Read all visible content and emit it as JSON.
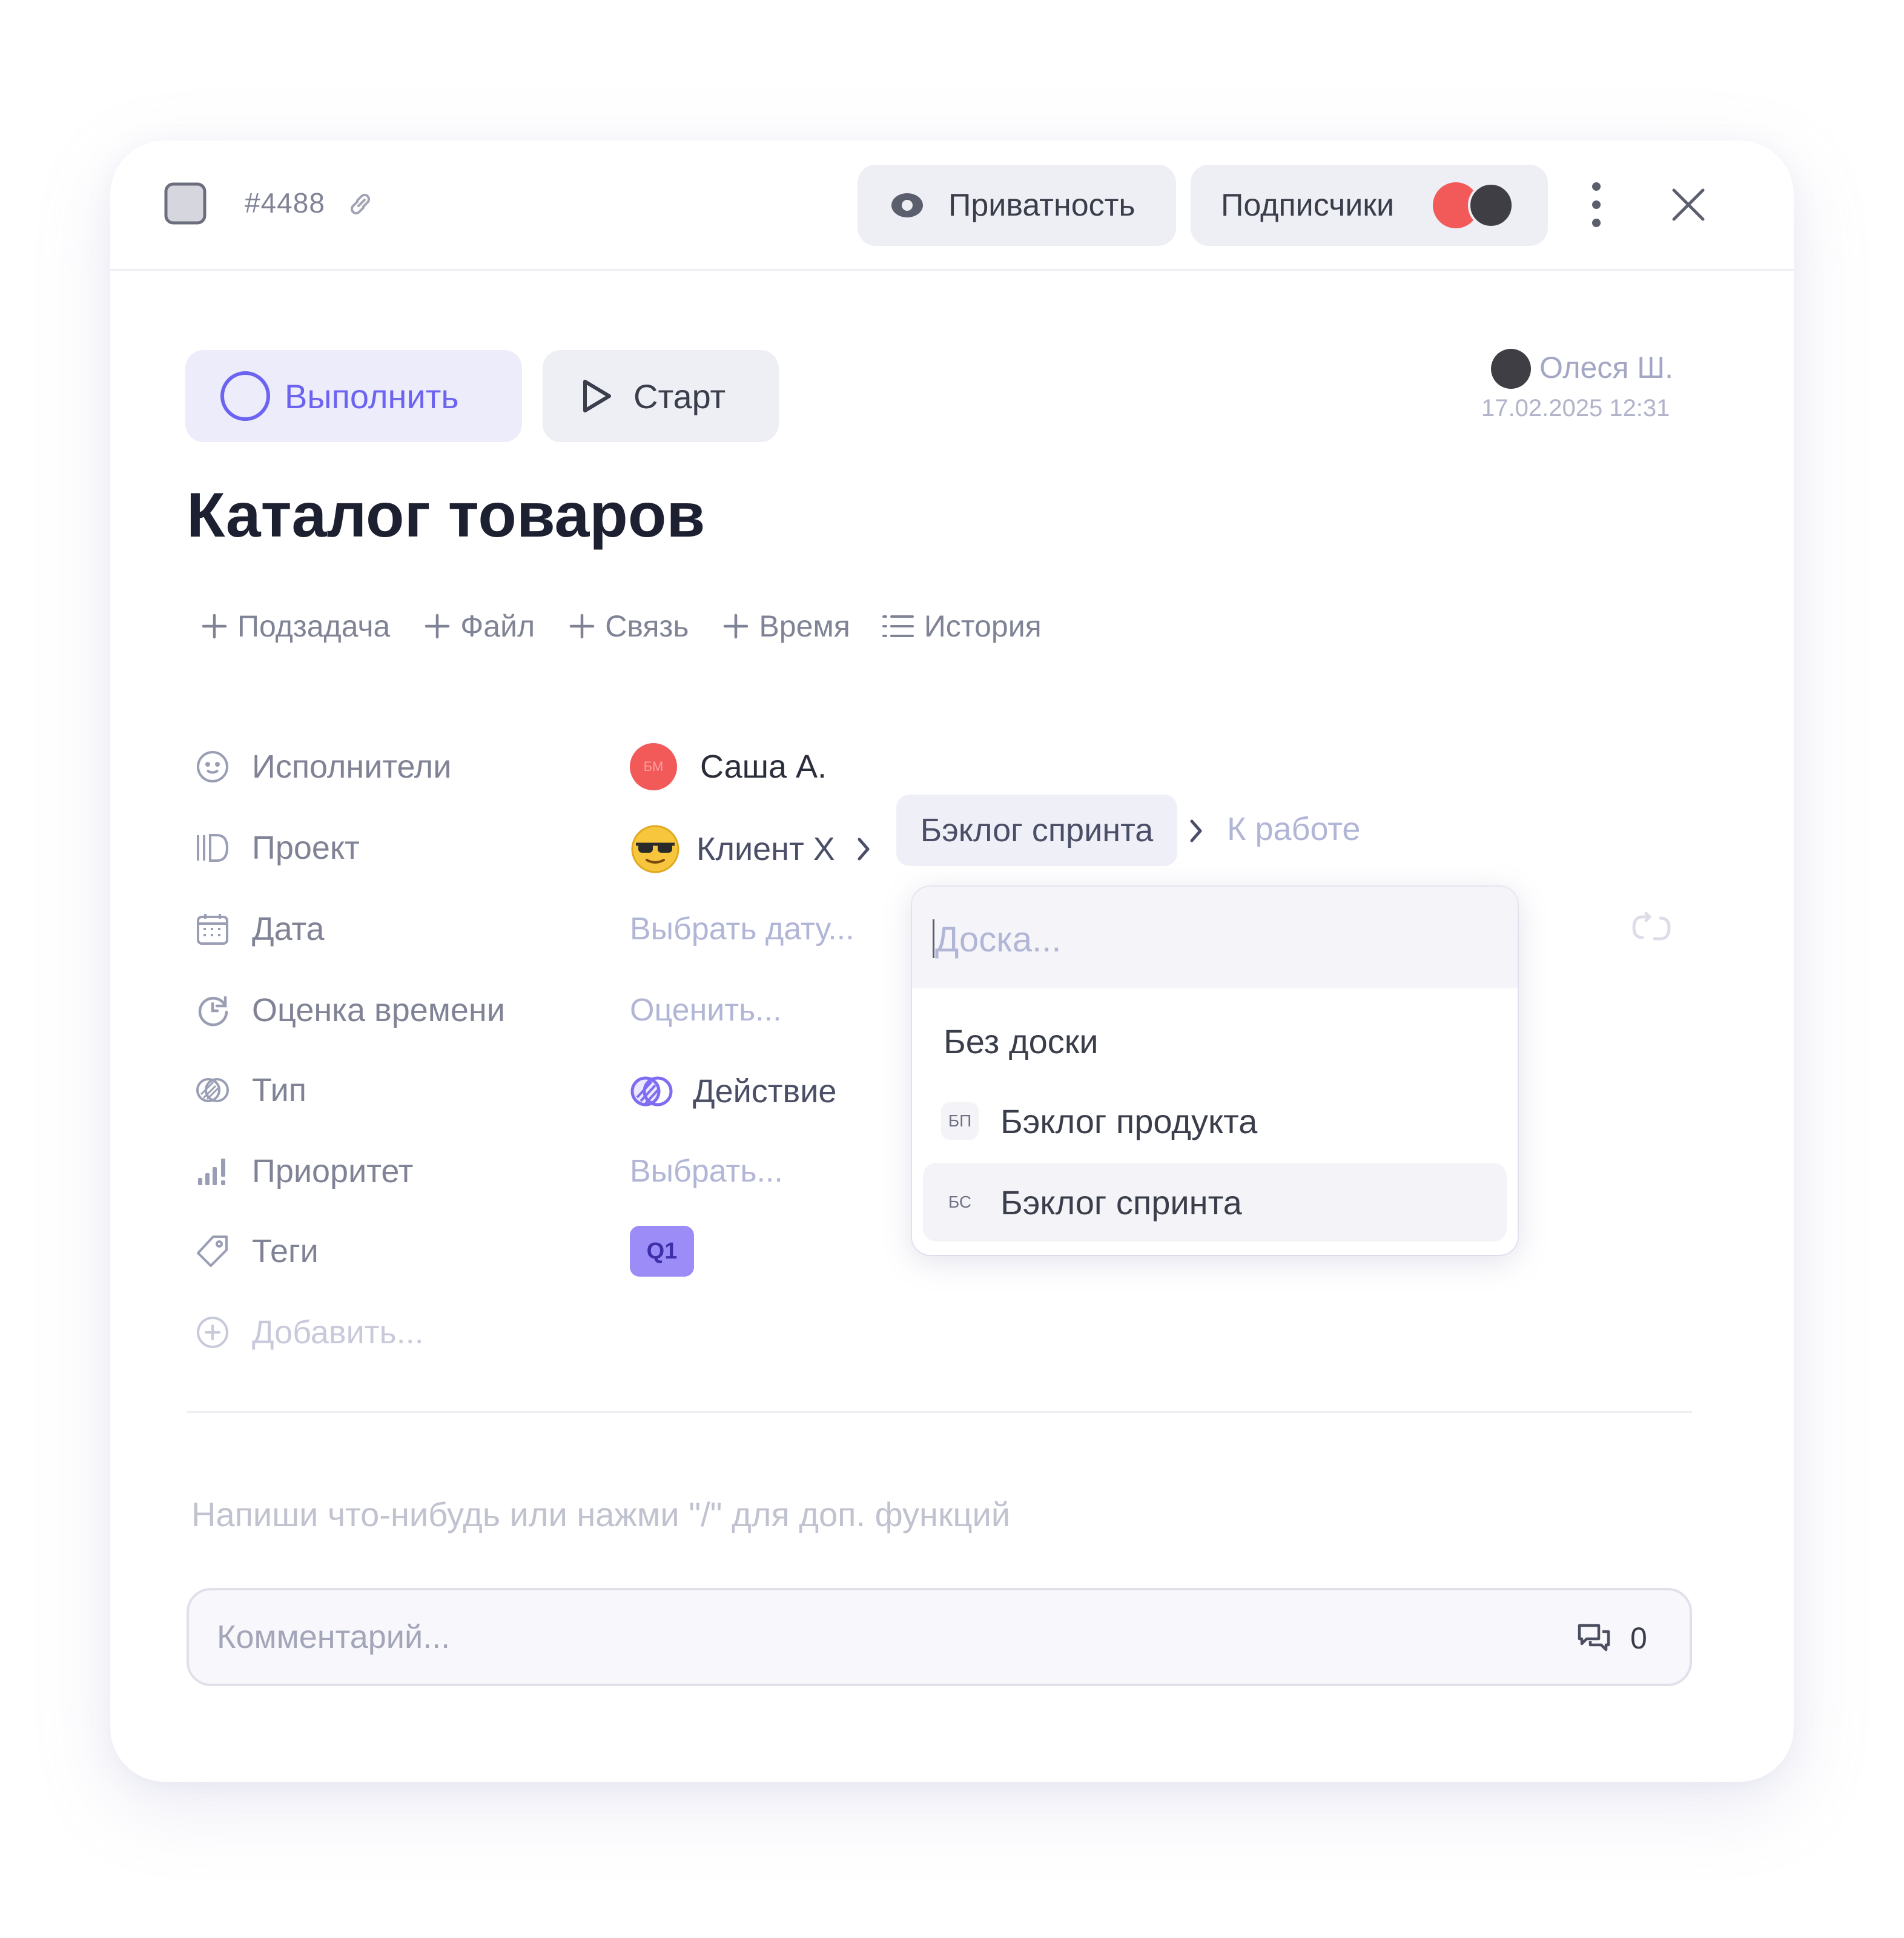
{
  "header": {
    "task_id": "#4488",
    "privacy_label": "Приватность",
    "subscribers_label": "Подписчики"
  },
  "actions": {
    "complete_label": "Выполнить",
    "start_label": "Старт"
  },
  "author": {
    "name": "Олеся Ш.",
    "timestamp": "17.02.2025 12:31"
  },
  "task": {
    "title": "Каталог товаров"
  },
  "quick_actions": [
    {
      "label": "Подзадача"
    },
    {
      "label": "Файл"
    },
    {
      "label": "Связь"
    },
    {
      "label": "Время"
    },
    {
      "label": "История"
    }
  ],
  "fields": {
    "assignees": {
      "label": "Исполнители",
      "value": "Саша А.",
      "avatar_text": "БМ"
    },
    "project": {
      "label": "Проект",
      "client": "Клиент X",
      "board": "Бэклог спринта",
      "column": "К работе"
    },
    "date": {
      "label": "Дата",
      "placeholder": "Выбрать дату..."
    },
    "estimate": {
      "label": "Оценка времени",
      "placeholder": "Оценить..."
    },
    "type": {
      "label": "Тип",
      "value": "Действие"
    },
    "priority": {
      "label": "Приоритет",
      "placeholder": "Выбрать..."
    },
    "tags": {
      "label": "Теги",
      "value": "Q1"
    },
    "add_label": "Добавить..."
  },
  "board_dropdown": {
    "search_placeholder": "Доска...",
    "items": [
      {
        "abbr": "",
        "label": "Без доски"
      },
      {
        "abbr": "БП",
        "label": "Бэклог продукта"
      },
      {
        "abbr": "БС",
        "label": "Бэклог спринта",
        "selected": true
      }
    ]
  },
  "editor": {
    "placeholder": "Напиши что-нибудь или нажми \"/\" для доп. функций"
  },
  "comment": {
    "placeholder": "Комментарий...",
    "count": "0"
  },
  "colors": {
    "accent": "#6c63f0",
    "avatar_red": "#f25a5a",
    "pill_bg": "#eeeef5",
    "tag_bg": "#9b8cf7"
  }
}
